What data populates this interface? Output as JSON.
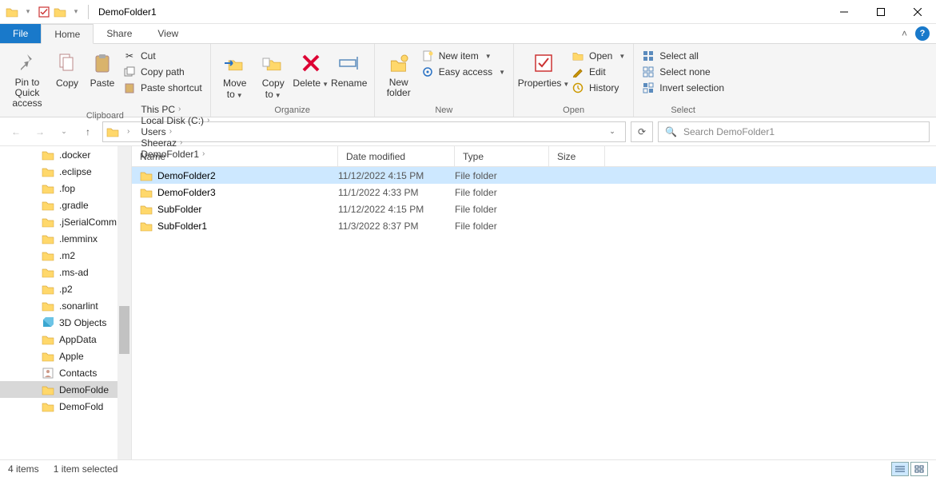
{
  "window": {
    "title": "DemoFolder1"
  },
  "tabs": {
    "file": "File",
    "home": "Home",
    "share": "Share",
    "view": "View"
  },
  "ribbon": {
    "clipboard": {
      "label": "Clipboard",
      "pin": "Pin to Quick access",
      "copy": "Copy",
      "paste": "Paste",
      "cut": "Cut",
      "copy_path": "Copy path",
      "paste_shortcut": "Paste shortcut"
    },
    "organize": {
      "label": "Organize",
      "move_to": "Move to",
      "copy_to": "Copy to",
      "delete": "Delete",
      "rename": "Rename"
    },
    "new": {
      "label": "New",
      "new_folder": "New folder",
      "new_item": "New item",
      "easy_access": "Easy access"
    },
    "open": {
      "label": "Open",
      "properties": "Properties",
      "open": "Open",
      "edit": "Edit",
      "history": "History"
    },
    "select": {
      "label": "Select",
      "select_all": "Select all",
      "select_none": "Select none",
      "invert": "Invert selection"
    }
  },
  "breadcrumbs": [
    "This PC",
    "Local Disk (C:)",
    "Users",
    "Sheeraz",
    "DemoFolder1"
  ],
  "search": {
    "placeholder": "Search DemoFolder1"
  },
  "tree": [
    {
      "name": ".docker"
    },
    {
      "name": ".eclipse"
    },
    {
      "name": ".fop"
    },
    {
      "name": ".gradle"
    },
    {
      "name": ".jSerialComm"
    },
    {
      "name": ".lemminx"
    },
    {
      "name": ".m2"
    },
    {
      "name": ".ms-ad"
    },
    {
      "name": ".p2"
    },
    {
      "name": ".sonarlint"
    },
    {
      "name": "3D Objects",
      "special": "3d"
    },
    {
      "name": "AppData"
    },
    {
      "name": "Apple"
    },
    {
      "name": "Contacts",
      "special": "contacts"
    },
    {
      "name": "DemoFolde",
      "selected": true
    },
    {
      "name": "DemoFold"
    }
  ],
  "columns": {
    "name": "Name",
    "date": "Date modified",
    "type": "Type",
    "size": "Size"
  },
  "rows": [
    {
      "name": "DemoFolder2",
      "date": "11/12/2022 4:15 PM",
      "type": "File folder",
      "selected": true
    },
    {
      "name": "DemoFolder3",
      "date": "11/1/2022 4:33 PM",
      "type": "File folder"
    },
    {
      "name": "SubFolder",
      "date": "11/12/2022 4:15 PM",
      "type": "File folder"
    },
    {
      "name": "SubFolder1",
      "date": "11/3/2022 8:37 PM",
      "type": "File folder"
    }
  ],
  "status": {
    "count": "4 items",
    "selection": "1 item selected"
  }
}
